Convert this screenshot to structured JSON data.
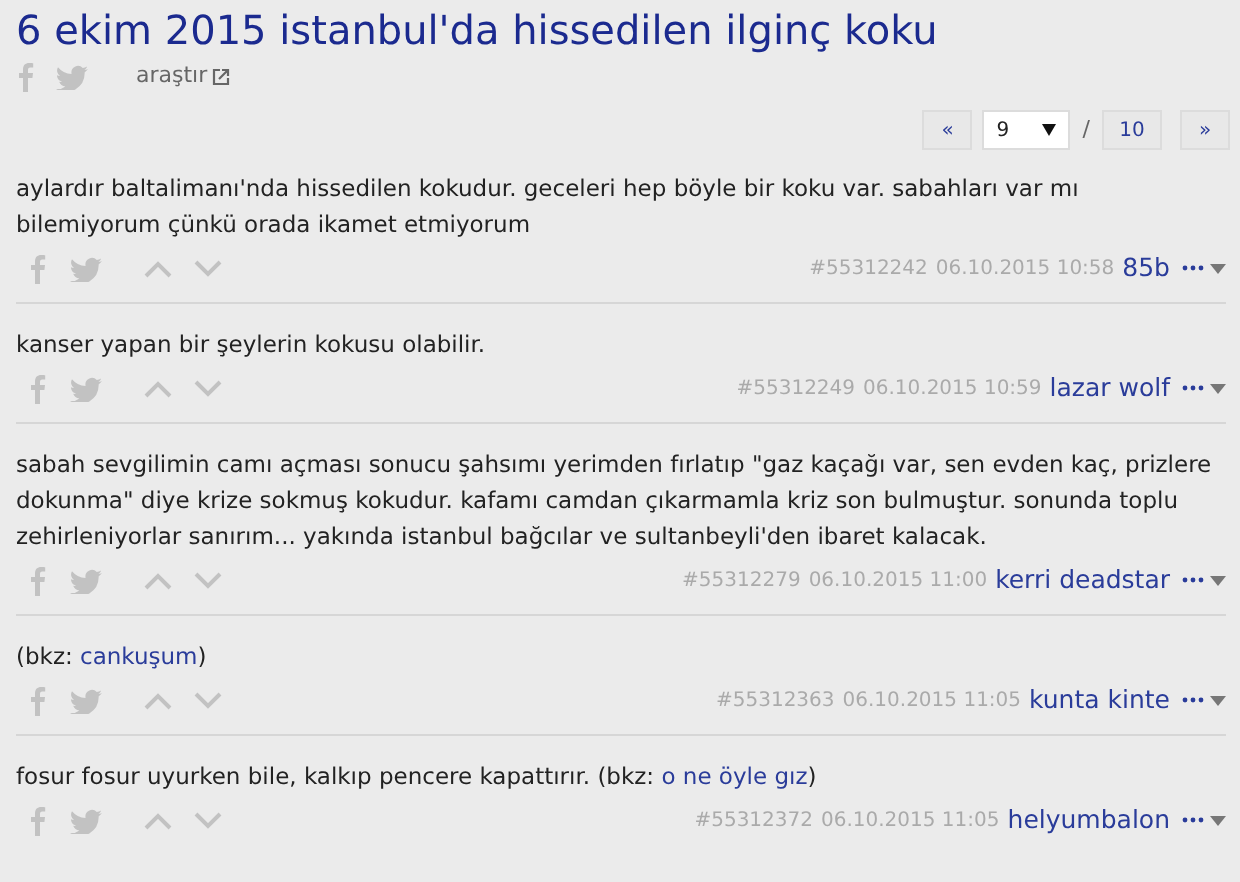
{
  "title": "6 ekim 2015 istanbul'da hissedilen ilginç koku",
  "share": {
    "search_link": "araştır"
  },
  "pager": {
    "prev": "«",
    "current": "9",
    "separator": "/",
    "total": "10",
    "next": "»"
  },
  "entries": [
    {
      "content": [
        {
          "kind": "text",
          "text": "aylardır baltalimanı'nda hissedilen kokudur. geceleri hep böyle bir koku var. sabahları var mı bilemiyorum çünkü orada ikamet etmiyorum"
        }
      ],
      "id": "#55312242",
      "date": "06.10.2015 10:58",
      "author": "85b"
    },
    {
      "content": [
        {
          "kind": "text",
          "text": "kanser yapan bir şeylerin kokusu olabilir."
        }
      ],
      "id": "#55312249",
      "date": "06.10.2015 10:59",
      "author": "lazar wolf"
    },
    {
      "content": [
        {
          "kind": "text",
          "text": "sabah sevgilimin camı açması sonucu şahsımı yerimden fırlatıp \"gaz kaçağı var, sen evden kaç, prizlere dokunma\" diye krize sokmuş kokudur. kafamı camdan çıkarmamla kriz son bulmuştur. sonunda toplu zehirleniyorlar sanırım... yakında istanbul bağcılar ve sultanbeyli'den ibaret kalacak."
        }
      ],
      "id": "#55312279",
      "date": "06.10.2015 11:00",
      "author": "kerri deadstar"
    },
    {
      "content": [
        {
          "kind": "text",
          "text": "(bkz: "
        },
        {
          "kind": "link",
          "text": "cankuşum"
        },
        {
          "kind": "text",
          "text": ")"
        }
      ],
      "id": "#55312363",
      "date": "06.10.2015 11:05",
      "author": "kunta kinte"
    },
    {
      "content": [
        {
          "kind": "text",
          "text": "fosur fosur uyurken bile, kalkıp pencere kapattırır. (bkz: "
        },
        {
          "kind": "link",
          "text": "o ne öyle gız"
        },
        {
          "kind": "text",
          "text": ")"
        }
      ],
      "id": "#55312372",
      "date": "06.10.2015 11:05",
      "author": "helyumbalon"
    }
  ]
}
